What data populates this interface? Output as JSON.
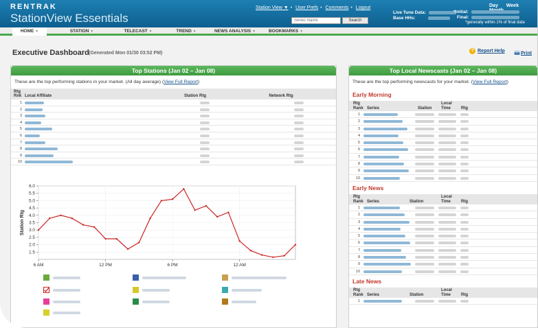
{
  "header": {
    "brand_top": "RENTRAK",
    "brand_bottom": "StationView Essentials",
    "links": [
      "Station View ▼",
      "User Prefs",
      "Comments",
      "Logout"
    ],
    "search_placeholder": "Series Name",
    "search_button": "Search",
    "live_tune_label": "Live Tune Data:",
    "base_hhs_label": "Base HHs:",
    "initial_label": "*Initial:",
    "final_label": "Final:",
    "period_tabs": [
      "Day",
      "Week",
      "Month"
    ],
    "note": "*generally within 1% of final data",
    "bg": "#1a78ab"
  },
  "nav": {
    "items": [
      "HOME",
      "STATION",
      "TELECAST",
      "TREND",
      "NEWS ANALYSIS",
      "BOOKMARKS"
    ],
    "accent": "#4aa84a"
  },
  "page": {
    "title": "Executive Dashboard",
    "generated": "(Generated Mon 01/30 03:52 PM)",
    "help": "Report Help",
    "print": "Print"
  },
  "stations": {
    "title": "Top Stations (Jan 02 – Jan 08)",
    "desc_prefix": "These are the top performing stations in your market. (All day average) (",
    "desc_link": "View Full Report",
    "desc_suffix": ")",
    "col_rank_top": "Rtg",
    "col_rank": "Rnk",
    "col_affiliate": "Local Affiliate",
    "col_station": "Station Rtg",
    "col_network": "Network Rtg",
    "ranks": [
      "1",
      "2",
      "3",
      "4",
      "5",
      "6",
      "7",
      "8",
      "9",
      "10"
    ]
  },
  "newscasts": {
    "title": "Top Local Newscasts (Jan 02 – Jan 08)",
    "desc_prefix": "These are the top performing newscasts for your market. (",
    "desc_link": "View Full Report",
    "desc_suffix": ")",
    "sections": [
      {
        "name": "Early Morning",
        "ranks": [
          "1",
          "2",
          "3",
          "4",
          "5",
          "6",
          "7",
          "8",
          "9",
          "10"
        ]
      },
      {
        "name": "Early News",
        "ranks": [
          "1",
          "2",
          "3",
          "4",
          "5",
          "6",
          "7",
          "8",
          "9",
          "10"
        ]
      },
      {
        "name": "Late News",
        "ranks": [
          "1"
        ]
      }
    ],
    "col_rank_top": "Rtg",
    "col_rank": "Rank",
    "col_series": "Series",
    "col_station": "Station",
    "col_local_top": "Local",
    "col_time": "Time",
    "col_rtg": "Rtg"
  },
  "chart_data": {
    "type": "line",
    "ylabel": "Station Rtg",
    "xlabel": "",
    "x_ticks": [
      "6 AM",
      "12 PM",
      "6 PM",
      "12 AM"
    ],
    "y_ticks": [
      "1.5",
      "2.0",
      "2.5",
      "3.0",
      "3.5",
      "4.0",
      "4.5",
      "5.0",
      "5.5",
      "6.0"
    ],
    "ylim": [
      1,
      6
    ],
    "grid": true,
    "series": [
      {
        "color": "#cc2222",
        "values": [
          3.0,
          3.8,
          4.0,
          3.8,
          3.35,
          3.2,
          2.4,
          2.4,
          1.7,
          2.15,
          3.8,
          5.0,
          5.1,
          5.8,
          4.35,
          4.65,
          3.9,
          4.2,
          2.25,
          1.6,
          1.3,
          1.15,
          1.25,
          2.0
        ]
      }
    ],
    "legend_colors": [
      "#6aaa3a",
      "#cc2222",
      "#e83e9a",
      "#d8d028",
      "#3a5fa8",
      "#d8c828",
      "#2a8a4a",
      "#c8a050",
      "#3aaab0",
      "#b07a1a"
    ]
  }
}
